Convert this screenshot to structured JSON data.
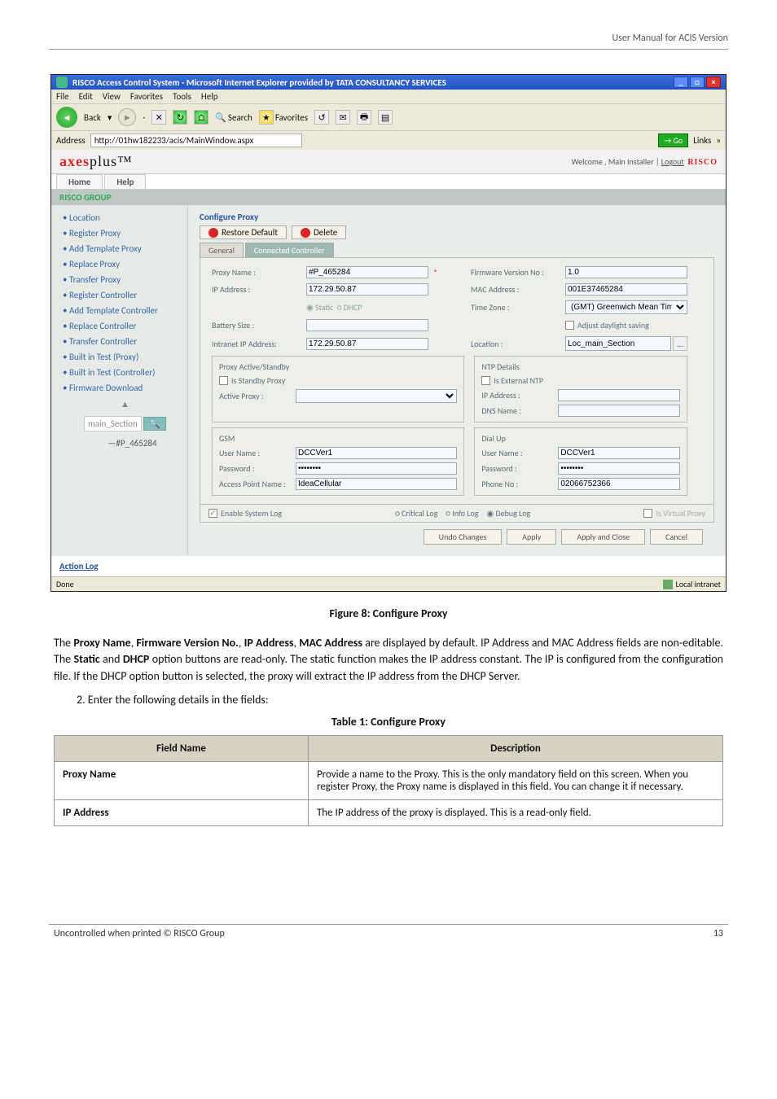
{
  "page": {
    "header_right": "User Manual for ACIS Version",
    "footer_left": "Uncontrolled when printed © RISCO Group",
    "footer_right": "13"
  },
  "ie": {
    "title": "RISCO Access Control System - Microsoft Internet Explorer provided by TATA CONSULTANCY SERVICES",
    "menus": [
      "File",
      "Edit",
      "View",
      "Favorites",
      "Tools",
      "Help"
    ],
    "back_label": "Back",
    "search_label": "Search",
    "favorites_label": "Favorites",
    "address_label": "Address",
    "address_value": "http://01hw182233/acis/MainWindow.aspx",
    "go_label": "Go",
    "links_label": "Links",
    "status_left": "Done",
    "status_right": "Local intranet"
  },
  "app": {
    "logo_a": "axes",
    "logo_b": "plus",
    "logo_tm": "™",
    "welcome": "Welcome , Main Installer | ",
    "logout": "Logout",
    "brand": "RISCO",
    "tabs": [
      "Home",
      "Help"
    ],
    "group_title": "RISCO GROUP",
    "side_items": [
      "Location",
      "Register Proxy",
      "Add Template Proxy",
      "Replace Proxy",
      "Transfer Proxy",
      "Register Controller",
      "Add Template Controller",
      "Replace Controller",
      "Transfer Controller",
      "Built in Test (Proxy)",
      "Built in Test (Controller)",
      "Firmware Download"
    ],
    "tree_node": "main_Section",
    "tree_leaf": "—#P_465284"
  },
  "cfg": {
    "title": "Configure Proxy",
    "restore": "Restore Default",
    "delete": "Delete",
    "tab_general": "General",
    "tab_connected": "Connected Controller",
    "labels": {
      "proxy_name": "Proxy Name :",
      "ip_address": "IP Address :",
      "battery": "Battery Size :",
      "intranet": "Intranet IP Address:",
      "active_proxy": "Active Proxy :",
      "fw_no": "Firmware Version No :",
      "mac": "MAC Address :",
      "timezone": "Time Zone :",
      "adjust": "Adjust daylight saving",
      "location": "Location :",
      "standby_legend": "Proxy Active/Standby",
      "is_standby": "Is Standby Proxy",
      "ntp_legend": "NTP Details",
      "is_ext_ntp": "Is External NTP",
      "ntp_ip": "IP Address :",
      "dns": "DNS Name :",
      "gsm_legend": "GSM",
      "gsm_user": "User Name :",
      "gsm_pass": "Password :",
      "gsm_apn": "Access Point Name :",
      "dial_legend": "Dial Up",
      "dial_user": "User Name :",
      "dial_pass": "Password :",
      "dial_phone": "Phone No :",
      "enable_log": "Enable System Log",
      "log_crit": "Critical Log",
      "log_info": "Info Log",
      "log_debug": "Debug Log",
      "is_virtual": "Is Virtual Proxy",
      "static": "Static",
      "dhcp": "DHCP"
    },
    "values": {
      "proxy_name": "#P_465284",
      "ip_address": "172.29.50.87",
      "intranet": "172.29.50.87",
      "fw_no": "1.0",
      "mac": "001E37465284",
      "timezone": "(GMT) Greenwich Mean Tim",
      "location": "Loc_main_Section",
      "gsm_user": "DCCVer1",
      "gsm_pass": "••••••••",
      "gsm_apn": "IdeaCellular",
      "dial_user": "DCCVer1",
      "dial_pass": "••••••••",
      "dial_phone": "02066752366"
    },
    "buttons": {
      "undo": "Undo Changes",
      "apply": "Apply",
      "apply_close": "Apply and Close",
      "cancel": "Cancel"
    },
    "action_log": "Action Log"
  },
  "fig_caption": "Figure 8: Configure Proxy",
  "body_para": "The Proxy Name, Firmware Version No., IP Address, MAC Address are displayed by default. IP Address and MAC Address fields are non-editable. The Static and DHCP option buttons are read-only. The static function makes the IP address constant. The IP is configured from the configuration file. If the DHCP option button is selected, the proxy will extract the IP address from the DHCP Server.",
  "step2": "2.    Enter the following details in the fields:",
  "table_title": "Table 1: Configure Proxy",
  "table": {
    "col1": "Field Name",
    "col2": "Description",
    "r1k": "Proxy Name",
    "r1v": "Provide a name to the Proxy. This is the only mandatory field on this screen. When you register Proxy, the Proxy name is displayed in this field. You can change it if necessary.",
    "r2k": "IP Address",
    "r2v": "The IP address of the proxy is displayed. This is a read-only field."
  }
}
